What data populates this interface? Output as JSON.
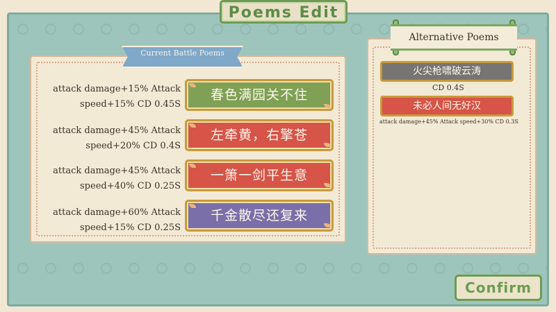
{
  "title": "Poems Edit",
  "current_section_label": "Current Battle Poems",
  "alternative_section_label": "Alternative Poems",
  "current_poems": [
    {
      "stat": "attack damage+15% Attack speed+15%  CD 0.45S",
      "poem": "春色满园关不住",
      "color": "#7fa055"
    },
    {
      "stat": "attack damage+45% Attack speed+20%  CD 0.4S",
      "poem": "左牵黄，右擎苍",
      "color": "#d65448"
    },
    {
      "stat": "attack damage+45% Attack speed+40%  CD 0.25S",
      "poem": "一箫一剑平生意",
      "color": "#d65448"
    },
    {
      "stat": "attack damage+60% Attack speed+15%  CD 0.25S",
      "poem": "千金散尽还复来",
      "color": "#7a6fa8"
    }
  ],
  "alternative_poems": [
    {
      "poem": "火尖枪啸破云涛",
      "stat": "CD 0.4S",
      "color": "#777573"
    },
    {
      "poem": "未必人间无好汉",
      "stat": "attack damage+45% Attack speed+30%  CD 0.3S",
      "color": "#d65448"
    }
  ],
  "confirm_label": "Confirm"
}
